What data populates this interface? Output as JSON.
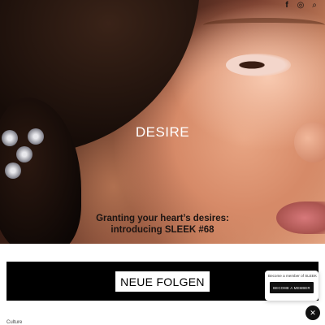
{
  "hero": {
    "title": "DESIRE",
    "caption_line1": "Granting your heart’s desires:",
    "caption_line2": "introducing SLEEK #68"
  },
  "social": {
    "facebook_icon": "f",
    "instagram_icon": "◎",
    "search_icon": "⌕"
  },
  "banner": {
    "label": "NEUE FOLGEN"
  },
  "member_popup": {
    "text": "Become a member of SLEEK",
    "button_label": "BECOME A MEMBER"
  },
  "close_icon": "✕",
  "category": "Culture",
  "colors": {
    "banner_bg": "#000000",
    "popup_button": "#111111"
  }
}
